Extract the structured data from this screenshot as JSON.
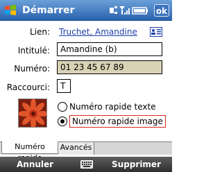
{
  "titlebar": {
    "title": "Démarrer",
    "ok_label": "ok",
    "icons": [
      "windows-start-icon",
      "connectivity-icon",
      "signal-icon",
      "battery-icon"
    ]
  },
  "form": {
    "lien_label": "Lien:",
    "lien_value": "Truchet, Amandine",
    "intitule_label": "Intitulé:",
    "intitule_value": "Amandine (b)",
    "numero_label": "Numéro:",
    "numero_value": "01 23 45 67 89",
    "raccourci_label": "Raccourci:",
    "raccourci_value": "T",
    "radio_options": [
      {
        "label": "Numéro rapide texte",
        "checked": false
      },
      {
        "label": "Numéro rapide image",
        "checked": true
      }
    ]
  },
  "tabs": [
    {
      "label": "Numéro rapide",
      "active": true
    },
    {
      "label": "Avancés",
      "active": false
    }
  ],
  "softkeys": {
    "left": "Annuler",
    "right": "Supprimer"
  },
  "colors": {
    "titlebar": "#2a62ae",
    "link": "#1c3fa8",
    "readonly_field": "#d9d3b6",
    "selection_border": "#d9261c",
    "softbar": "#2e2e2e"
  }
}
